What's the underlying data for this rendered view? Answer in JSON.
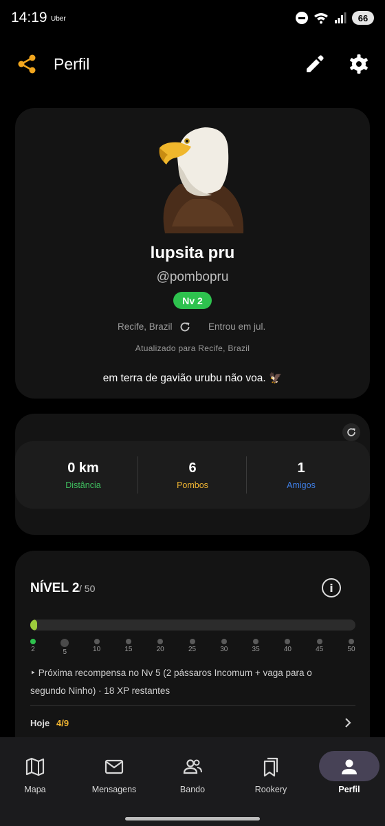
{
  "status_bar": {
    "time": "14:19",
    "carrier": "Uber",
    "battery": "66"
  },
  "header": {
    "title": "Perfil"
  },
  "profile": {
    "display_name": "lupsita pru",
    "username": "@pombopru",
    "level_badge": "Nv 2",
    "location": "Recife, Brazil",
    "joined": "Entrou em jul.",
    "updated": "Atualizado para Recife, Brazil",
    "bio": "em terra de gavião urubu não voa. 🦅"
  },
  "stats": [
    {
      "value": "0 km",
      "label": "Distância",
      "color": "#3fbf5f"
    },
    {
      "value": "6",
      "label": "Pombos",
      "color": "#f2b632"
    },
    {
      "value": "1",
      "label": "Amigos",
      "color": "#3f7fe6"
    }
  ],
  "level": {
    "title": "NÍVEL 2",
    "max": "/ 50",
    "progress": 0.02,
    "milestones": [
      "2",
      "5",
      "10",
      "15",
      "20",
      "25",
      "30",
      "35",
      "40",
      "45",
      "50"
    ],
    "next_reward": "‣ Próxima recompensa no Nv 5 (2 pássaros Incomum + vaga para o segundo Ninho) · 18 XP restantes",
    "today_label": "Hoje",
    "today_value": "4/9"
  },
  "nav": [
    {
      "label": "Mapa",
      "icon": "map-icon"
    },
    {
      "label": "Mensagens",
      "icon": "mail-icon"
    },
    {
      "label": "Bando",
      "icon": "group-icon"
    },
    {
      "label": "Rookery",
      "icon": "bookmarks-icon"
    },
    {
      "label": "Perfil",
      "icon": "person-icon",
      "active": true
    }
  ],
  "colors": {
    "accent": "#f2a61e",
    "badge_green": "#2ec24e",
    "card": "#141414",
    "nav_bg": "#1b1b1d"
  }
}
